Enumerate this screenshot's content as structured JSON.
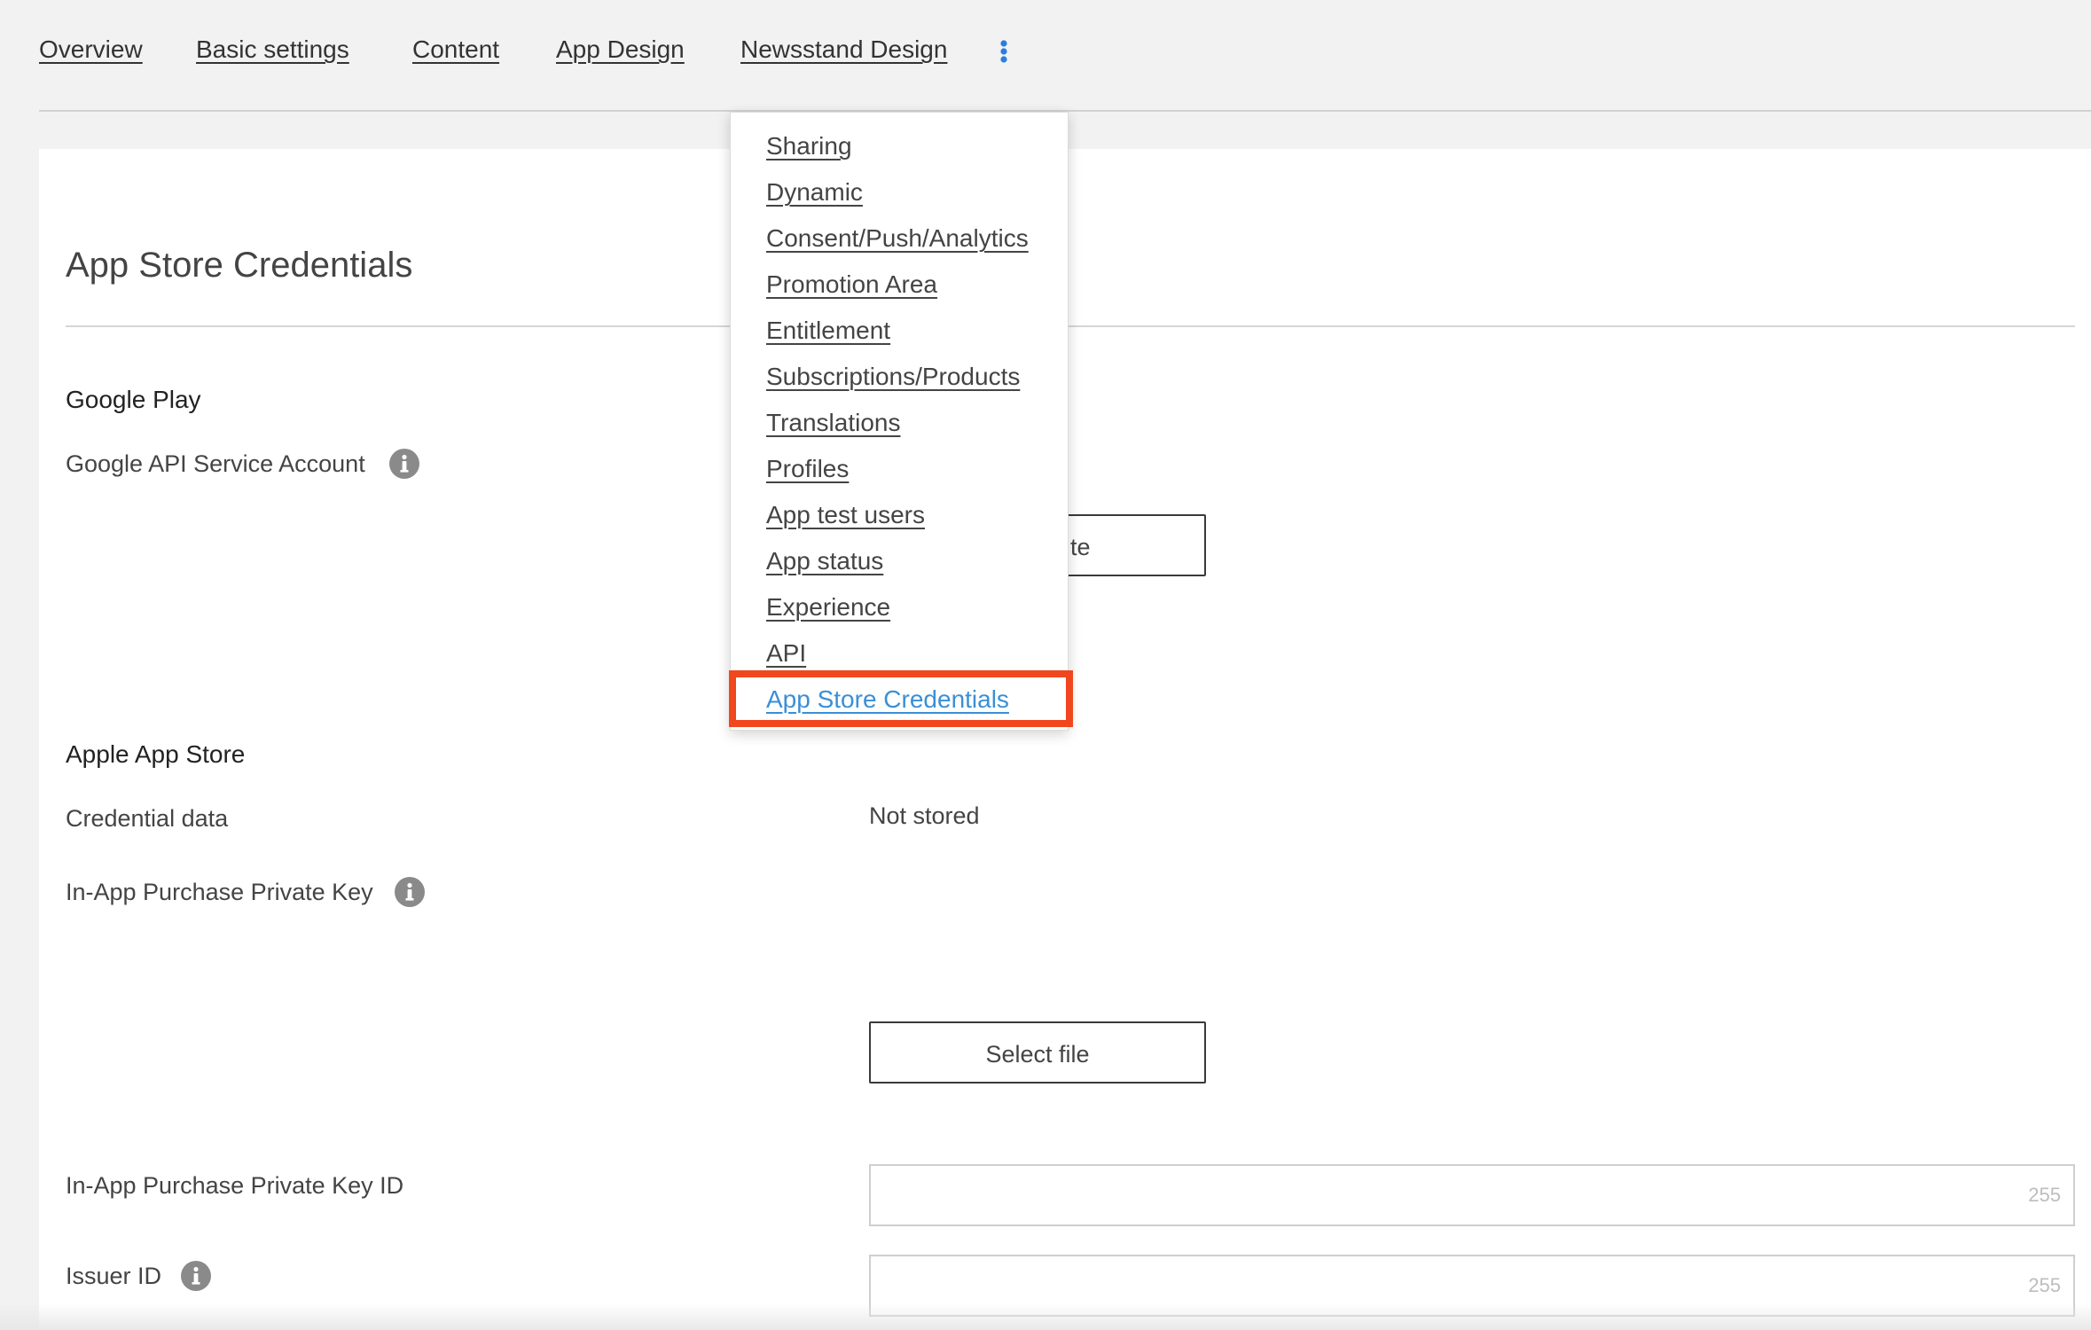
{
  "nav": {
    "tabs": [
      {
        "label": "Overview"
      },
      {
        "label": "Basic settings"
      },
      {
        "label": "Content"
      },
      {
        "label": "App Design"
      },
      {
        "label": "Newsstand Design"
      }
    ],
    "more_icon": "kebab-vertical-icon"
  },
  "dropdown": {
    "items": [
      "Sharing",
      "Dynamic",
      "Consent/Push/Analytics",
      "Promotion Area",
      "Entitlement",
      "Subscriptions/Products",
      "Translations",
      "Profiles",
      "App test users",
      "App status",
      "Experience",
      "API",
      "App Store Credentials"
    ],
    "active_item": "App Store Credentials"
  },
  "page": {
    "title": "App Store Credentials"
  },
  "google_play": {
    "heading": "Google Play",
    "service_account_label": "Google API Service Account",
    "service_account_button": "te"
  },
  "apple": {
    "heading": "Apple App Store",
    "credential_label": "Credential data",
    "credential_value": "Not stored",
    "private_key_label": "In-App Purchase Private Key",
    "select_file_label": "Select file",
    "key_id_label": "In-App Purchase Private Key ID",
    "key_id_value": "",
    "key_id_counter": "255",
    "issuer_label": "Issuer ID",
    "issuer_value": "",
    "issuer_counter": "255"
  },
  "icons": {
    "info": "info-icon",
    "more": "kebab-vertical-icon"
  },
  "colors": {
    "background": "#f2f2f2",
    "panel": "#ffffff",
    "text": "#333333",
    "active_link": "#3a8fd6",
    "highlight_box": "#f0471f",
    "kebab": "#2a7de1",
    "info_icon": "#8a8a8a"
  }
}
